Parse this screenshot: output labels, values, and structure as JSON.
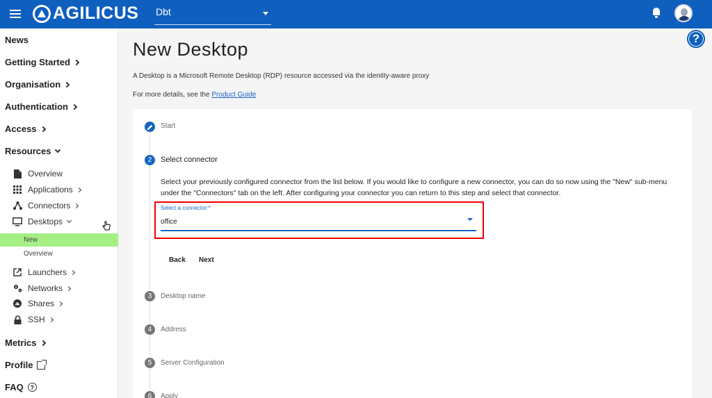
{
  "header": {
    "logo_text": "AGILICUS",
    "org_value": "Dbt",
    "icons": [
      "menu-icon",
      "bell-icon",
      "avatar",
      "help-icon"
    ],
    "brand_color": "#0f5fbf"
  },
  "sidebar": {
    "news": "News",
    "getting_started": "Getting Started",
    "organisation": "Organisation",
    "authentication": "Authentication",
    "access": "Access",
    "resources": "Resources",
    "resources_items": {
      "overview": "Overview",
      "applications": "Applications",
      "connectors": "Connectors",
      "desktops": "Desktops",
      "desktops_new": "New",
      "desktops_overview": "Overview",
      "launchers": "Launchers",
      "networks": "Networks",
      "shares": "Shares",
      "ssh": "SSH"
    },
    "metrics": "Metrics",
    "profile": "Profile",
    "faq": "FAQ",
    "active_color": "#a5ef84"
  },
  "main": {
    "title": "New Desktop",
    "description": "A Desktop is a Microsoft Remote Desktop (RDP) resource accessed via the identity-aware proxy",
    "details_prefix": "For more details, see the",
    "details_link": "Product Guide",
    "help_symbol": "?"
  },
  "stepper": {
    "steps": [
      {
        "num": "✎",
        "label": "Start",
        "state": "done"
      },
      {
        "num": "2",
        "label": "Select connector",
        "state": "active"
      },
      {
        "num": "3",
        "label": "Desktop name",
        "state": "pending"
      },
      {
        "num": "4",
        "label": "Address",
        "state": "pending"
      },
      {
        "num": "5",
        "label": "Server Configuration",
        "state": "pending"
      },
      {
        "num": "6",
        "label": "Apply",
        "state": "pending"
      }
    ],
    "body_text": "Select your previously configured connector from the list below. If you would like to configure a new connector, you can do so now using the \"New\" sub-menu under the \"Connectors\" tab on the left. After configuring your connector you can return to this step and select that connector.",
    "select_label": "Select a connector:",
    "select_required": "*",
    "select_value": "office",
    "back_label": "Back",
    "next_label": "Next"
  }
}
